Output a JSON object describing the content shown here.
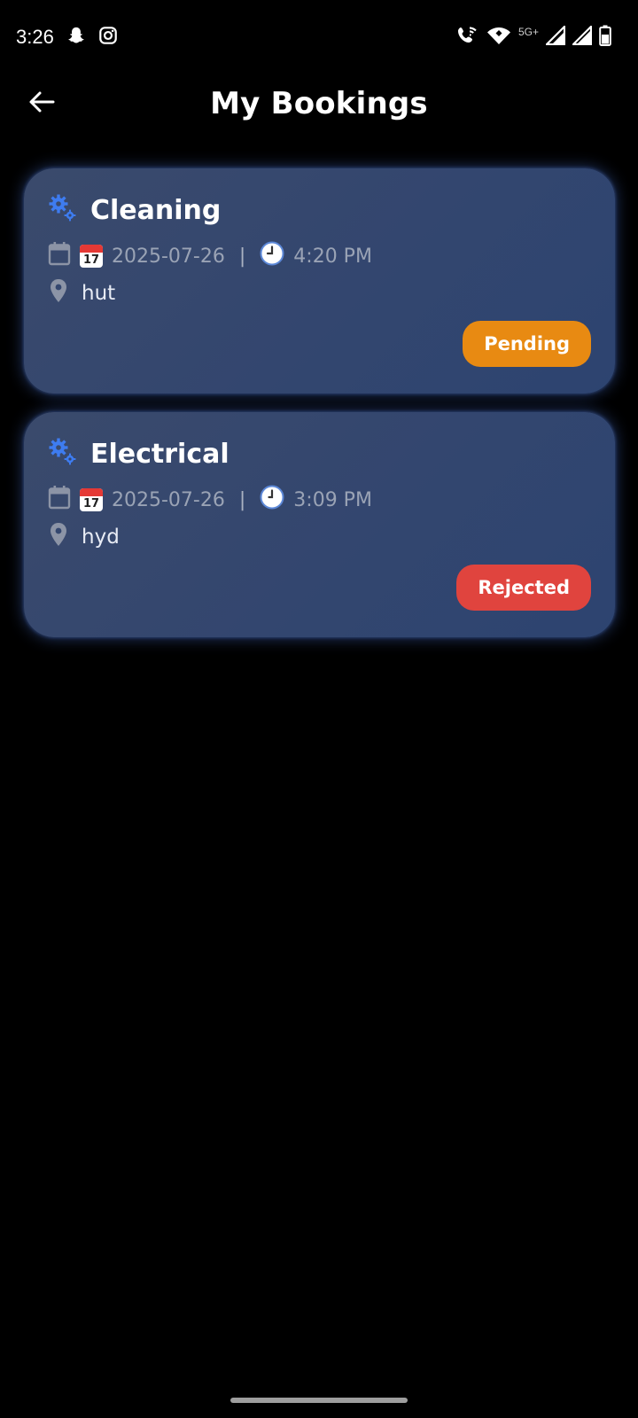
{
  "status_bar": {
    "time": "3:26",
    "network_label": "5G+"
  },
  "app_bar": {
    "title": "My Bookings"
  },
  "colors": {
    "gear_icon": "#3e7cf0",
    "pending": "#e88a12",
    "rejected": "#e0443e",
    "muted_text": "#9aa3b5"
  },
  "bookings": [
    {
      "service": "Cleaning",
      "date": "2025-07-26",
      "separator": "|",
      "time": "4:20 PM",
      "location": "hut",
      "calendar_emoji_day": "17",
      "status": "Pending",
      "status_color": "#e88a12"
    },
    {
      "service": "Electrical",
      "date": "2025-07-26",
      "separator": "|",
      "time": "3:09 PM",
      "location": "hyd",
      "calendar_emoji_day": "17",
      "status": "Rejected",
      "status_color": "#e0443e"
    }
  ]
}
